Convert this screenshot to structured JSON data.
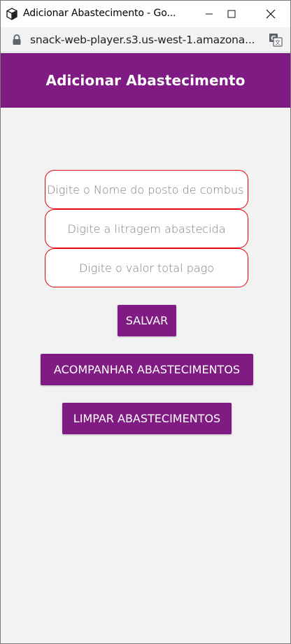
{
  "window": {
    "title": "Adicionar Abastecimento - Go..."
  },
  "browser": {
    "url": "snack-web-player.s3.us-west-1.amazona..."
  },
  "app": {
    "header_title": "Adicionar Abastecimento",
    "fields": {
      "station_placeholder": "Digite o Nome do posto de combus",
      "liters_placeholder": "Digite a litragem abastecida",
      "total_placeholder": "Digite o valor total pago"
    },
    "buttons": {
      "save": "SALVAR",
      "follow": "ACOMPANHAR ABASTECIMENTOS",
      "clear": "LIMPAR ABASTECIMENTOS"
    }
  },
  "colors": {
    "primary": "#801b83",
    "field_border": "#e8000b",
    "background": "#f2f2f2"
  },
  "icons": {
    "app": "cube-icon",
    "lock": "lock-icon",
    "translate": "translate-icon",
    "minimize": "minimize-icon",
    "maximize": "maximize-icon",
    "close": "close-icon"
  }
}
